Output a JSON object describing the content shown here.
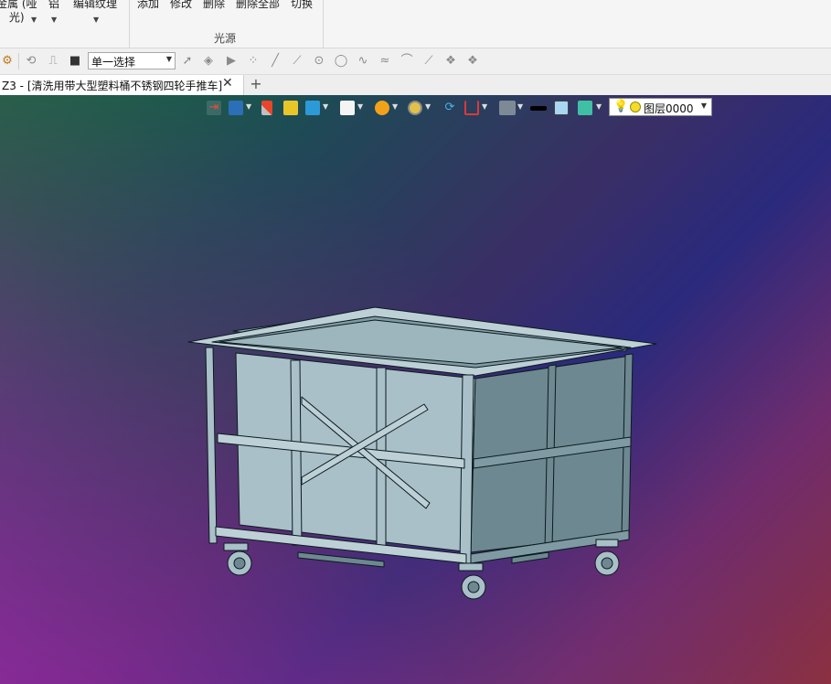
{
  "ribbon": {
    "items": [
      {
        "line1": "金属 (哑",
        "line2": "光)"
      },
      {
        "line1": "铝",
        "line2": ""
      },
      {
        "line1": "编辑纹理",
        "line2": ""
      },
      {
        "line1": "添加",
        "line2": ""
      },
      {
        "line1": "修改",
        "line2": ""
      },
      {
        "line1": "删除",
        "line2": ""
      },
      {
        "line1": "删除全部",
        "line2": ""
      },
      {
        "line1": "切换",
        "line2": ""
      }
    ],
    "group_label": "光源"
  },
  "toolbar": {
    "select_mode": "单一选择"
  },
  "tabs": {
    "document_title": "Z3 - [清洗用带大型塑料桶不锈钢四轮手推车]",
    "close_symbol": "✕",
    "add_symbol": "+"
  },
  "viewport": {
    "layer": "图层0000"
  },
  "colors": {
    "model_fill": "#a9c0c8",
    "model_shadow": "#6d8890",
    "model_edge": "#0c1a20"
  }
}
